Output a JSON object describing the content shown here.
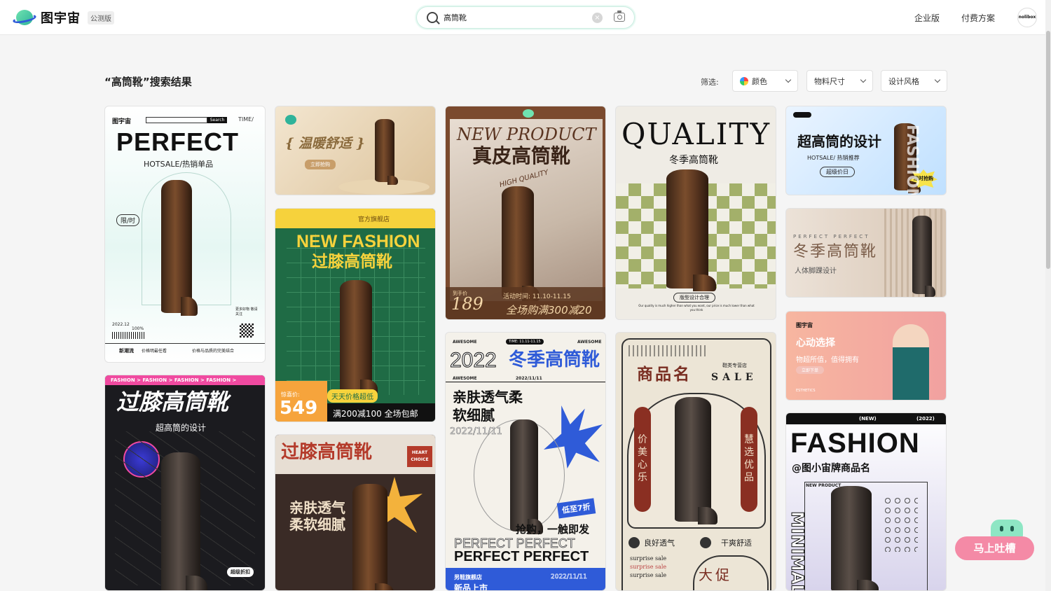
{
  "app": {
    "name": "图宇宙",
    "beta_label": "公测版"
  },
  "search": {
    "value": "高筒靴",
    "clear_glyph": "×"
  },
  "nav": {
    "enterprise": "企业版",
    "pricing": "付费方案",
    "user": "nolibox"
  },
  "page": {
    "title": "“高筒靴”搜索结果"
  },
  "filters": {
    "label": "筛选:",
    "color": "颜色",
    "size": "物料尺寸",
    "style": "设计风格"
  },
  "cards": {
    "c1": {
      "brand": "图宇宙",
      "search": "Search",
      "time": "TIME/",
      "title": "PERFECT",
      "sub": "HOTSALE/热销单品",
      "tag": "限/时",
      "date": "2022.12",
      "pct": "100%",
      "more": "更多好物 敬请关注",
      "f1": "新潮流",
      "f2": "价格明最任看",
      "f3": "价格与品质的完美结合"
    },
    "c2": {
      "title": "{ 温暖舒适 }",
      "btn": "立即抢购"
    },
    "c3": {
      "title_en": "NEW PRODUCT",
      "title": "真皮高筒靴",
      "script": "HIGH QUALITY",
      "price_label": "到手价",
      "price": "189",
      "time": "活动时间: 11.10-11.15",
      "promo": "全场购满300减20"
    },
    "c4": {
      "title": "QUALITY",
      "sub": "冬季高筒靴",
      "btn": "版型设计合理",
      "foot": "Our quality is much higher than what you want, our price is much lower than what you think"
    },
    "c5": {
      "title": "超高筒的设计",
      "sub": "HOTSALE/ 热销推荐",
      "btn": "超级价日",
      "badge": "限时抢购",
      "side": "FASHION"
    },
    "c6": {
      "shop": "官方旗舰店",
      "title_en": "NEW FASHION",
      "title": "过膝高筒靴",
      "price_label": "惊喜价:",
      "price": "549",
      "tag": "天天价格超低",
      "promo": "满200减100 全场包邮"
    },
    "c7": {
      "kicker": "PERFECT PERFECT",
      "title": "冬季高筒靴",
      "sub": "人体脚踝设计"
    },
    "c8": {
      "tag": "AWESOME",
      "time": "TIME: 11.11-11.15",
      "title_num": "2022",
      "title": "冬季高筒靴",
      "date": "2022/11/11",
      "line1": "亲肤透气柔",
      "line2": "软细腻",
      "badge": "低至7折",
      "cta": "抢购，一触即发",
      "en": "PERFECT PERFECT",
      "store": "男鞋旗舰店",
      "new": "新品上市"
    },
    "c9": {
      "brand": "图宇宙",
      "title": "心动选择",
      "sub": "物超所值，值得拥有",
      "btn": "立即下单",
      "foot": "ESTHETICS"
    },
    "c10": {
      "crumbs": "FASHION > FASHION > FASHION > FASHION >",
      "title": "过膝高筒靴",
      "sub": "超高筒的设计",
      "badge": "超级折扣"
    },
    "c11": {
      "title": "过膝高筒靴",
      "badge": "HEART CHOICE",
      "line1": "亲肤透气",
      "line2": "柔软细腻"
    },
    "c12": {
      "title": "商品名",
      "shop": "鞋类专营店",
      "sale": "SALE",
      "left": "价美心乐",
      "right": "慧选优品",
      "feat1": "良好透气",
      "feat2": "干爽舒适",
      "s1": "surprise sale",
      "promo": "大促"
    },
    "c13": {
      "head": "(NEW)",
      "year": "(2022)",
      "title": "FASHION",
      "sub": "@图小宙牌商品名",
      "new": "NEW PRODUCT",
      "side": "MINIMAL"
    }
  },
  "feedback": {
    "label": "马上吐槽"
  },
  "colors": {
    "accent": "#2fb39a",
    "brand_blue": "#2f5bd8",
    "feedback": "#f48aa6"
  }
}
